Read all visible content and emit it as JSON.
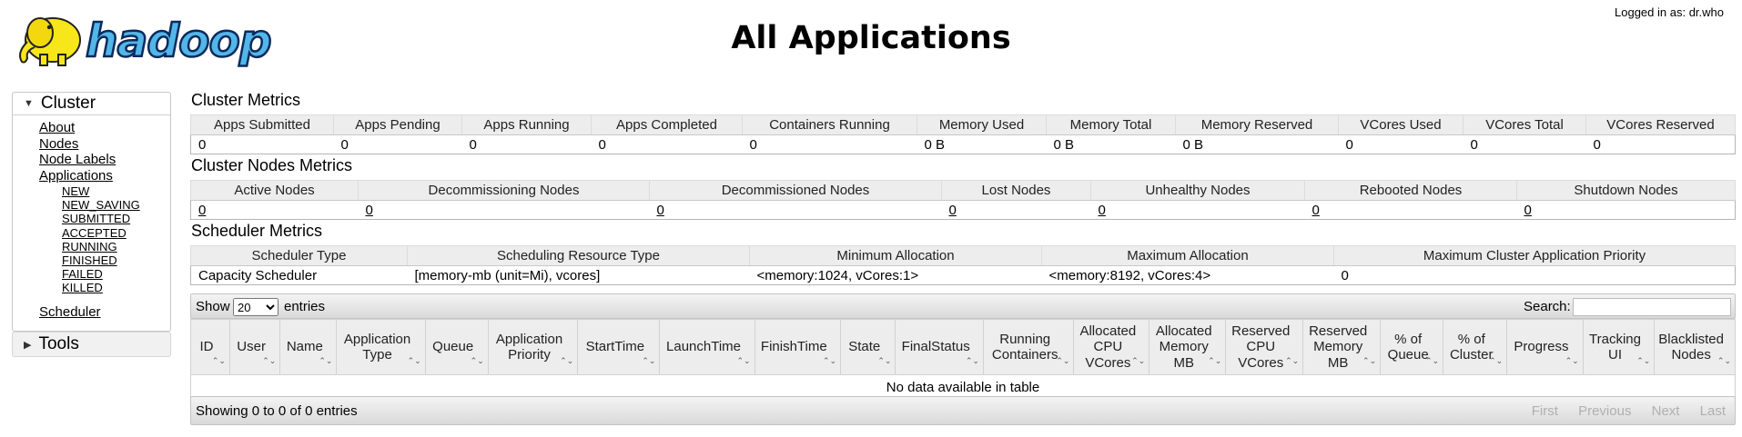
{
  "header": {
    "logo_text": "hadoop",
    "title": "All Applications",
    "logged_in": "Logged in as: dr.who"
  },
  "nav": {
    "cluster_label": "Cluster",
    "cluster_links": [
      "About",
      "Nodes",
      "Node Labels",
      "Applications"
    ],
    "app_states": [
      "NEW",
      "NEW_SAVING",
      "SUBMITTED",
      "ACCEPTED",
      "RUNNING",
      "FINISHED",
      "FAILED",
      "KILLED"
    ],
    "scheduler": "Scheduler",
    "tools_label": "Tools"
  },
  "cluster_metrics": {
    "title": "Cluster Metrics",
    "headers": [
      "Apps Submitted",
      "Apps Pending",
      "Apps Running",
      "Apps Completed",
      "Containers Running",
      "Memory Used",
      "Memory Total",
      "Memory Reserved",
      "VCores Used",
      "VCores Total",
      "VCores Reserved"
    ],
    "values": [
      "0",
      "0",
      "0",
      "0",
      "0",
      "0 B",
      "0 B",
      "0 B",
      "0",
      "0",
      "0"
    ]
  },
  "nodes_metrics": {
    "title": "Cluster Nodes Metrics",
    "headers": [
      "Active Nodes",
      "Decommissioning Nodes",
      "Decommissioned Nodes",
      "Lost Nodes",
      "Unhealthy Nodes",
      "Rebooted Nodes",
      "Shutdown Nodes"
    ],
    "values": [
      "0",
      "0",
      "0",
      "0",
      "0",
      "0",
      "0"
    ]
  },
  "scheduler_metrics": {
    "title": "Scheduler Metrics",
    "headers": [
      "Scheduler Type",
      "Scheduling Resource Type",
      "Minimum Allocation",
      "Maximum Allocation",
      "Maximum Cluster Application Priority"
    ],
    "values": [
      "Capacity Scheduler",
      "[memory-mb (unit=Mi), vcores]",
      "<memory:1024, vCores:1>",
      "<memory:8192, vCores:4>",
      "0"
    ]
  },
  "apps_table": {
    "show_label": "Show",
    "entries_value": "20",
    "entries_label": "entries",
    "search_label": "Search:",
    "columns": [
      "ID",
      "User",
      "Name",
      "Application Type",
      "Queue",
      "Application Priority",
      "StartTime",
      "LaunchTime",
      "FinishTime",
      "State",
      "FinalStatus",
      "Running Containers",
      "Allocated CPU VCores",
      "Allocated Memory MB",
      "Reserved CPU VCores",
      "Reserved Memory MB",
      "% of Queue",
      "% of Cluster",
      "Progress",
      "Tracking UI",
      "Blacklisted Nodes"
    ],
    "empty_message": "No data available in table",
    "showing": "Showing 0 to 0 of 0 entries",
    "pager": [
      "First",
      "Previous",
      "Next",
      "Last"
    ]
  }
}
